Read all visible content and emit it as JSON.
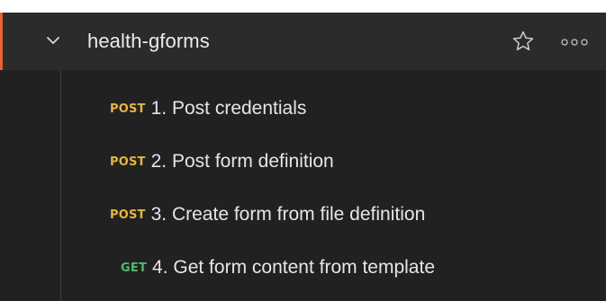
{
  "collection": {
    "name": "health-gforms",
    "accent_color": "#e8622d",
    "icons": [
      "chevron-down-icon",
      "star-icon",
      "more-options-icon"
    ]
  },
  "requests": [
    {
      "method": "POST",
      "name": "1. Post credentials",
      "method_color": "#e7b53c"
    },
    {
      "method": "POST",
      "name": "2. Post form definition",
      "method_color": "#e7b53c"
    },
    {
      "method": "POST",
      "name": "3. Create form from file definition",
      "method_color": "#e7b53c"
    },
    {
      "method": "GET",
      "name": "4. Get form content from template",
      "method_color": "#4fb96f"
    }
  ]
}
